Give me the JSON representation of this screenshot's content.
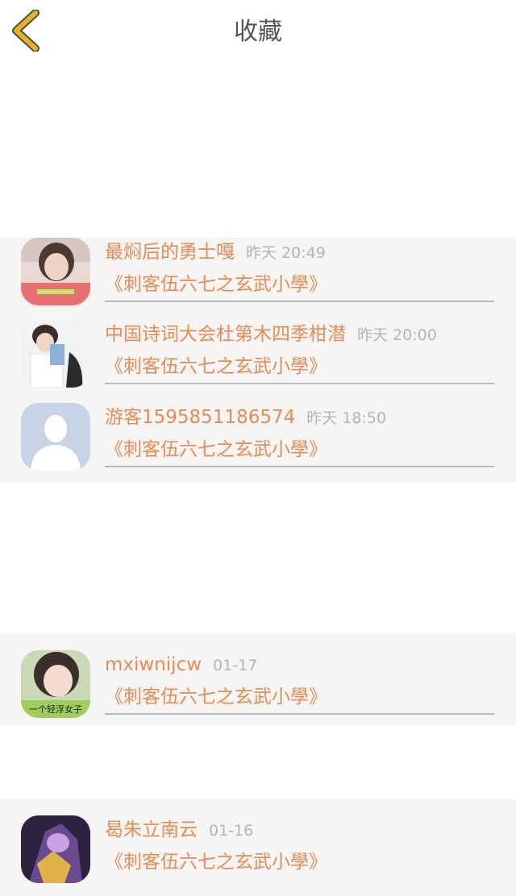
{
  "header": {
    "title": "收藏",
    "back_icon": "chevron-left-icon",
    "back_icon_color": "#e5b422"
  },
  "favorites": [
    {
      "username": "最焖后的勇士嘎",
      "time": "昨天 20:49",
      "work": "《刺客伍六七之玄武小學》",
      "avatar": "girl-photo-avatar"
    },
    {
      "username": "中国诗词大会杜第木四季柑潜",
      "time": "昨天 20:00",
      "work": "《刺客伍六七之玄武小學》",
      "avatar": "boy-photo-avatar"
    },
    {
      "username": "游客1595851186574",
      "time": "昨天 18:50",
      "work": "《刺客伍六七之玄武小學》",
      "avatar": "default-person-avatar"
    },
    {
      "username": "mxiwnijcw",
      "time": "01-17",
      "work": "《刺客伍六七之玄武小學》",
      "avatar": "girl-portrait-avatar",
      "avatar_caption": "一个轻浮女子"
    },
    {
      "username": "曷朱立南云",
      "time": "01-16",
      "work": "《刺客伍六七之玄武小學》",
      "avatar": "game-character-avatar"
    }
  ],
  "colors": {
    "accent": "#e58c55",
    "time_text": "#b4b4b4",
    "background": "#f7f4f4"
  }
}
